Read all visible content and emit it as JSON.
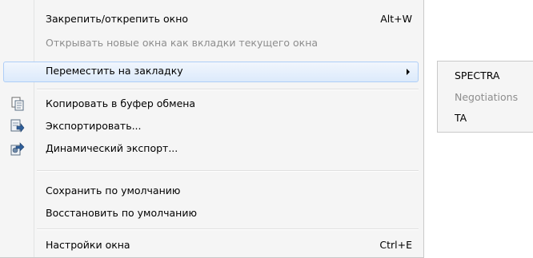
{
  "menu": {
    "items": [
      {
        "label": "Закрепить/открепить окно",
        "shortcut": "Alt+W"
      },
      {
        "label": "Открывать новые окна как вкладки текущего окна",
        "disabled": true
      },
      {
        "label": "Переместить на закладку",
        "submenu": true,
        "highlighted": true
      },
      {
        "label": "Копировать в буфер обмена",
        "icon": "copy-icon"
      },
      {
        "label": "Экспортировать...",
        "icon": "export-icon"
      },
      {
        "label": "Динамический экспорт...",
        "icon": "dynamic-export-icon"
      },
      {
        "label": "Сохранить по умолчанию"
      },
      {
        "label": "Восстановить по умолчанию"
      },
      {
        "label": "Настройки окна",
        "shortcut": "Ctrl+E"
      }
    ]
  },
  "submenu": {
    "items": [
      {
        "label": "SPECTRA"
      },
      {
        "label": "Negotiations",
        "disabled": true
      },
      {
        "label": "TA"
      }
    ]
  },
  "colors": {
    "menu_background": "#f5f5f5",
    "highlight_border": "#aecef7",
    "disabled_text": "#8d8d8d"
  }
}
